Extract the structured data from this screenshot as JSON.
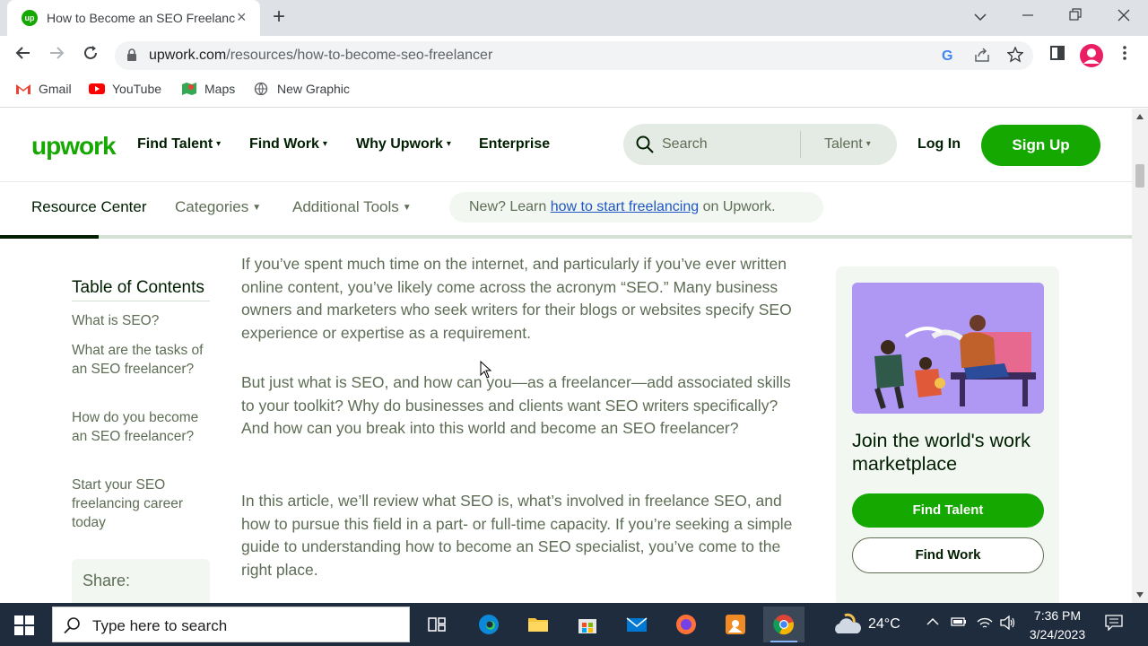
{
  "browser": {
    "tab": {
      "title": "How to Become an SEO Freelancer",
      "favicon_text": "up"
    },
    "url": {
      "domain": "upwork.com",
      "path": "/resources/how-to-become-seo-freelancer"
    },
    "bookmarks": [
      {
        "label": "Gmail",
        "icon": "gmail-icon"
      },
      {
        "label": "YouTube",
        "icon": "youtube-icon"
      },
      {
        "label": "Maps",
        "icon": "maps-icon"
      },
      {
        "label": "New Graphic",
        "icon": "globe-icon"
      }
    ]
  },
  "site": {
    "logo": "upwork",
    "nav": [
      {
        "label": "Find Talent",
        "dropdown": true
      },
      {
        "label": "Find Work",
        "dropdown": true
      },
      {
        "label": "Why Upwork",
        "dropdown": true
      },
      {
        "label": "Enterprise",
        "dropdown": false
      }
    ],
    "search": {
      "placeholder": "Search",
      "scope": "Talent"
    },
    "login": "Log In",
    "signup": "Sign Up",
    "subnav": {
      "active": "Resource Center",
      "categories": "Categories",
      "tools": "Additional Tools",
      "new_prefix": "New? Learn ",
      "new_link": "how to start freelancing",
      "new_suffix": " on Upwork."
    },
    "reading_progress": 0.087
  },
  "toc": {
    "title": "Table of Contents",
    "items": [
      "What is SEO?",
      "What are the tasks of an SEO freelancer?",
      "How do you become an SEO freelancer?",
      "Start your SEO freelancing career today"
    ],
    "share_label": "Share:"
  },
  "article": {
    "paragraphs": [
      "If you’ve spent much time on the internet, and particularly if you’ve ever written online content, you’ve likely come across the acronym “SEO.” Many business owners and marketers who seek writers for their blogs or websites specify SEO experience or expertise as a requirement.",
      "But just what is SEO, and how can you—as a freelancer—add associated skills to your toolkit? Why do businesses and clients want SEO writers specifically? And how can you break into this world and become an SEO freelancer?",
      "In this article, we’ll review what SEO is, what’s involved in freelance SEO, and how to pursue this field in a part- or full-time capacity. If you’re seeking a simple guide to understanding how to become an SEO specialist, you’ve come to the right place."
    ]
  },
  "card": {
    "heading": "Join the world's work marketplace",
    "find_talent": "Find Talent",
    "find_work": "Find Work"
  },
  "taskbar": {
    "search_placeholder": "Type here to search",
    "temperature": "24°C",
    "time": "7:36 PM",
    "date": "3/24/2023"
  },
  "colors": {
    "brand_green": "#14a800",
    "text_dark": "#001e00",
    "text_muted": "#5e6d55",
    "link_blue": "#1f57c3"
  }
}
